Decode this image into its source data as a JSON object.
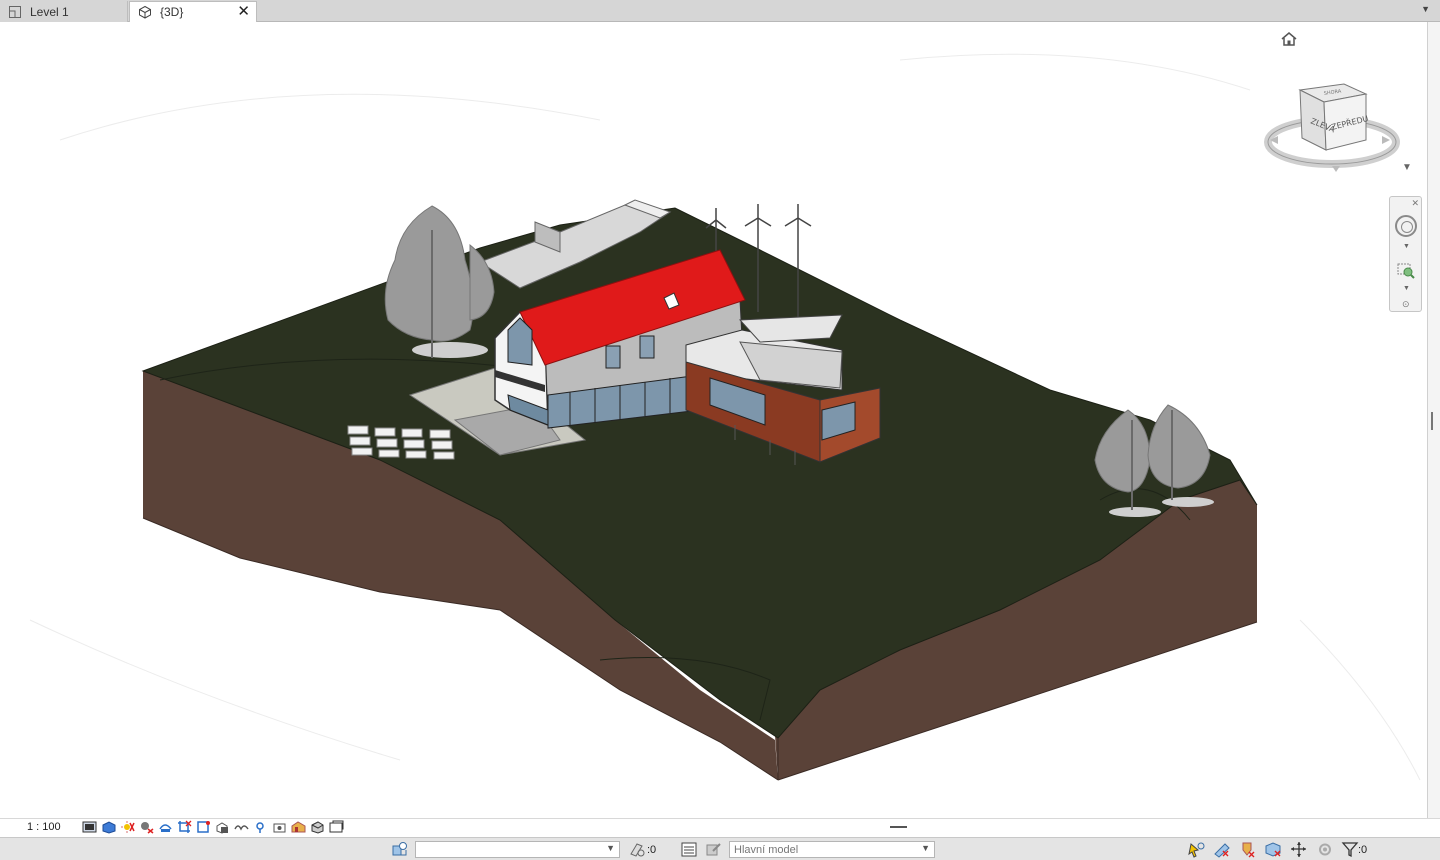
{
  "tabs": [
    {
      "label": "Level 1",
      "icon": "floor-plan-icon",
      "active": false
    },
    {
      "label": "{3D}",
      "icon": "3d-view-icon",
      "active": true
    }
  ],
  "viewcube": {
    "face_left": "ZLEVA",
    "face_front": "ZEPŘEDU",
    "face_top": "SHORA"
  },
  "view_control": {
    "scale": "1 : 100"
  },
  "status": {
    "worksets_count": ":0",
    "active_model": "Hlavní model",
    "filter_count": ":0"
  },
  "colors": {
    "terrain": "#2b3220",
    "soil": "#5a4238",
    "roof": "#e01a1a",
    "cladding": "#8a3a22",
    "trees": "#9a9a9a"
  }
}
